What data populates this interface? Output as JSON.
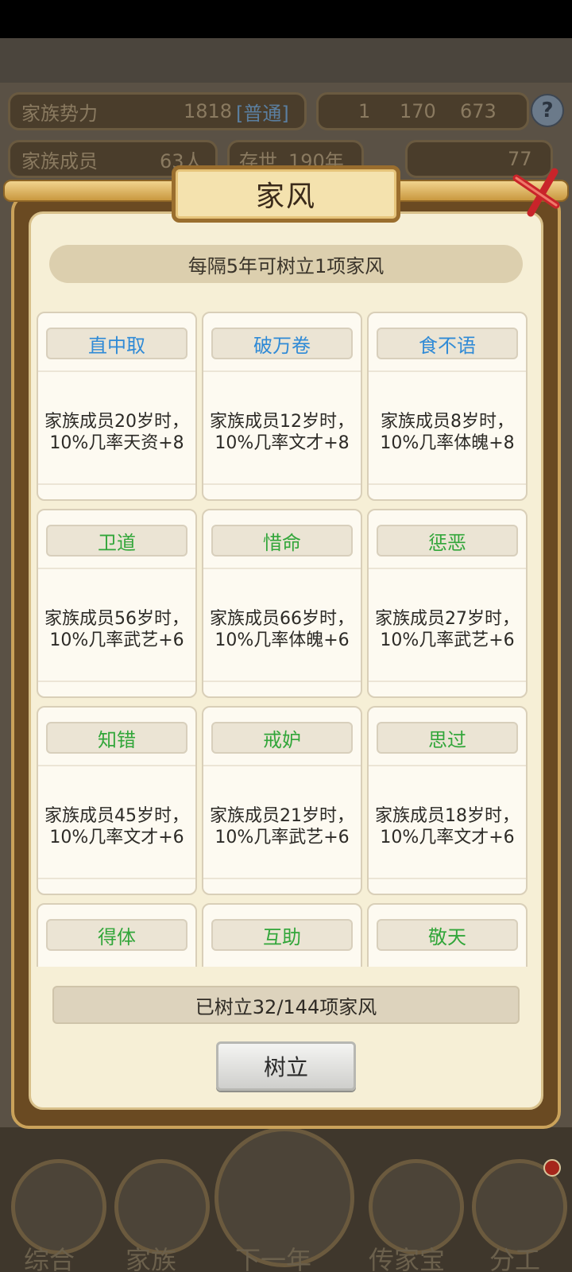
{
  "background": {
    "stats": {
      "power_label": "家族势力",
      "power_value": "1818",
      "power_tag": "[普通]",
      "members_label": "家族成员",
      "members_value": "63人",
      "existed_label": "存世",
      "existed_value": "190年",
      "currency_1": "1",
      "currency_2": "170",
      "currency_3": "673",
      "ingot": "77"
    },
    "help_icon": "?",
    "nav": [
      "综合",
      "家族",
      "下一年",
      "传家宝",
      "分工"
    ]
  },
  "modal": {
    "title": "家风",
    "info": "每隔5年可树立1项家风",
    "cards": [
      {
        "name": "直中取",
        "desc": "家族成员20岁时，10%几率天资+8"
      },
      {
        "name": "破万卷",
        "desc": "家族成员12岁时，10%几率文才+8"
      },
      {
        "name": "食不语",
        "desc": "家族成员8岁时，10%几率体魄+8"
      },
      {
        "name": "卫道",
        "desc": "家族成员56岁时，10%几率武艺+6"
      },
      {
        "name": "惜命",
        "desc": "家族成员66岁时，10%几率体魄+6"
      },
      {
        "name": "惩恶",
        "desc": "家族成员27岁时，10%几率武艺+6"
      },
      {
        "name": "知错",
        "desc": "家族成员45岁时，10%几率文才+6"
      },
      {
        "name": "戒妒",
        "desc": "家族成员21岁时，10%几率武艺+6"
      },
      {
        "name": "思过",
        "desc": "家族成员18岁时，10%几率文才+6"
      },
      {
        "name": "得体",
        "desc": ""
      },
      {
        "name": "互助",
        "desc": ""
      },
      {
        "name": "敬天",
        "desc": ""
      }
    ],
    "count_text": "已树立32/144项家风",
    "confirm_label": "树立"
  },
  "colors": {
    "rare_name": "#2f8ad6",
    "common_name": "#32a63a",
    "panel_bg": "#f6efd6",
    "frame": "#6a4a22"
  }
}
